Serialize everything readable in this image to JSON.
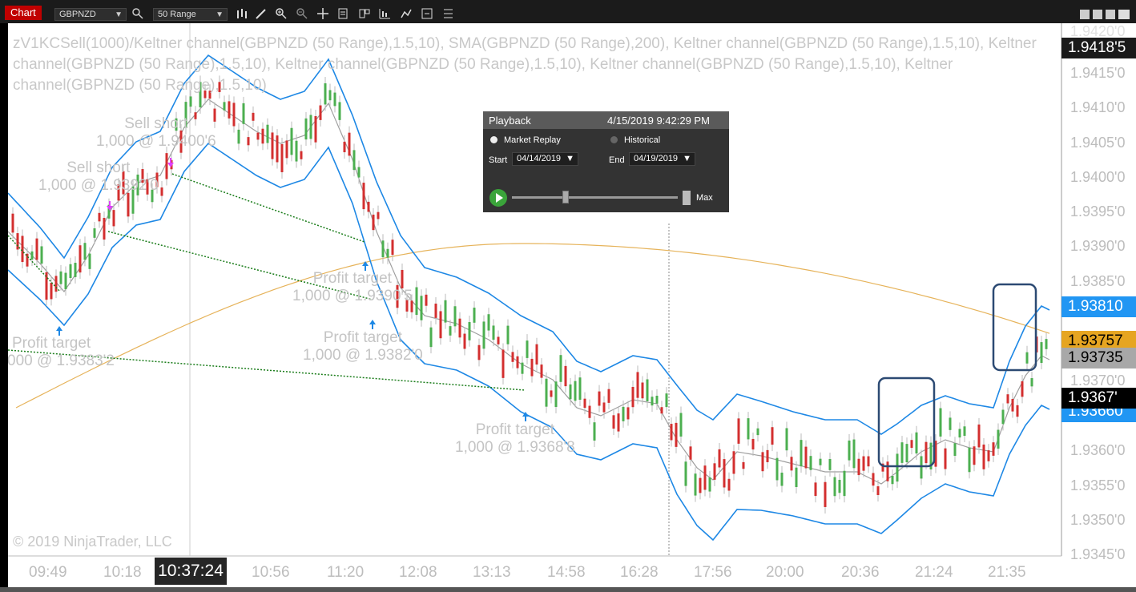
{
  "toolbar": {
    "tab_label": "Chart",
    "instrument": "GBPNZD",
    "interval": "50 Range"
  },
  "legend": {
    "text": "zV1KCSell(1000)/Keltner channel(GBPNZD (50 Range),1.5,10), SMA(GBPNZD (50 Range),200), Keltner channel(GBPNZD (50 Range),1.5,10), Keltner channel(GBPNZD (50 Range),1.5,10), Keltner channel(GBPNZD (50 Range),1.5,10), Keltner channel(GBPNZD (50 Range),1.5,10), Keltner channel(GBPNZD (50 Range),1.5,10)"
  },
  "copyright": "© 2019 NinjaTrader, LLC",
  "price_axis": {
    "ticks": [
      "1.9415'0",
      "1.9410'0",
      "1.9405'0",
      "1.9400'0",
      "1.9395'0",
      "1.9390'0",
      "1.9385'0",
      "1.9370'0",
      "1.9360'0",
      "1.9355'0",
      "1.9350'0",
      "1.9345'0"
    ],
    "top_partial": "1.9420'0"
  },
  "price_tags": [
    {
      "label": "1.9418'5",
      "bg": "#1a1a1a",
      "fg": "#ffffff"
    },
    {
      "label": "1.93810",
      "bg": "#2196f3",
      "fg": "#ffffff"
    },
    {
      "label": "1.93757",
      "bg": "#e6a521",
      "fg": "#000000"
    },
    {
      "label": "1.93735",
      "bg": "#a8a8a8",
      "fg": "#000000"
    },
    {
      "label": "1.9367'",
      "bg": "#000000",
      "fg": "#ffffff"
    },
    {
      "label": "1.93660",
      "bg": "#2196f3",
      "fg": "#ffffff"
    }
  ],
  "time_axis": {
    "labels": [
      "09:49",
      "10:18",
      "10:56",
      "11:20",
      "12:08",
      "13:13",
      "14:58",
      "16:28",
      "17:56",
      "20:00",
      "20:36",
      "21:24",
      "21:35"
    ],
    "cursor_time": "10:37:24"
  },
  "annotations": [
    {
      "line1": "Sell short",
      "line2": "1,000 @ 1.9400'6"
    },
    {
      "line1": "Sell short",
      "line2": "1,000 @ 1.9392'0"
    },
    {
      "line1": "Profit target",
      "line2": "1,000 @ 1.9390'5"
    },
    {
      "line1": "Profit target",
      "line2": "1,000 @ 1.9382'0"
    },
    {
      "line1": "Profit target",
      "line2": "000 @ 1.9383'2"
    },
    {
      "line1": "Profit target",
      "line2": "1,000 @ 1.9368'8"
    }
  ],
  "playback": {
    "title": "Playback",
    "datetime": "4/15/2019 9:42:29 PM",
    "mode_market_replay": "Market Replay",
    "mode_historical": "Historical",
    "start_label": "Start",
    "start_value": "04/14/2019",
    "end_label": "End",
    "end_value": "04/19/2019",
    "speed_label": "Max",
    "speed_fraction": 0.3
  },
  "colors": {
    "keltner_band": "#1e88e5",
    "keltner_mid": "#9e9e9e",
    "sma": "#e6b35a",
    "up_bar": "#4caf50",
    "down_bar": "#d32f2f",
    "trade_line": "#1b7d1b",
    "highlight_box": "#2c4a73"
  }
}
